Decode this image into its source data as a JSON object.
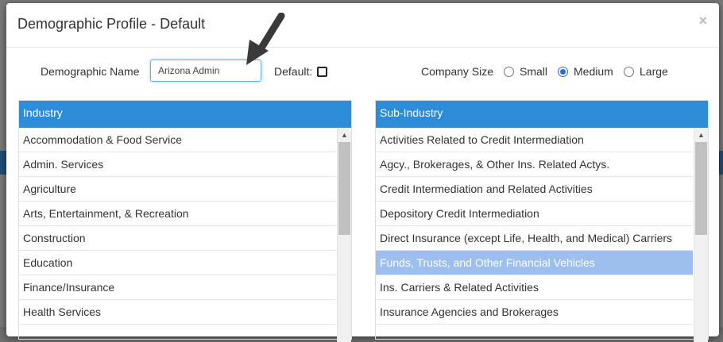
{
  "modal": {
    "title": "Demographic Profile - Default",
    "close": "×"
  },
  "form": {
    "name_label": "Demographic Name",
    "name_value": "Arizona Admin",
    "default_label": "Default:",
    "company_size_label": "Company Size",
    "sizes": [
      "Small",
      "Medium",
      "Large"
    ],
    "selected_size": "Medium"
  },
  "industry": {
    "header": "Industry",
    "items": [
      "Accommodation & Food Service",
      "Admin. Services",
      "Agriculture",
      "Arts, Entertainment, & Recreation",
      "Construction",
      "Education",
      "Finance/Insurance",
      "Health Services"
    ]
  },
  "subindustry": {
    "header": "Sub-Industry",
    "items": [
      "Activities Related to Credit Intermediation",
      "Agcy., Brokerages, & Other Ins. Related Actys.",
      "Credit Intermediation and Related Activities",
      "Depository Credit Intermediation",
      "Direct Insurance (except Life, Health, and Medical) Carriers",
      "Funds, Trusts, and Other Financial Vehicles",
      "Ins. Carriers & Related Activities",
      "Insurance Agencies and Brokerages"
    ],
    "selected_index": 5
  },
  "colors": {
    "header_blue": "#2d8cd8",
    "selected_row": "#9cbfee",
    "radio_accent": "#2a6fd6"
  }
}
